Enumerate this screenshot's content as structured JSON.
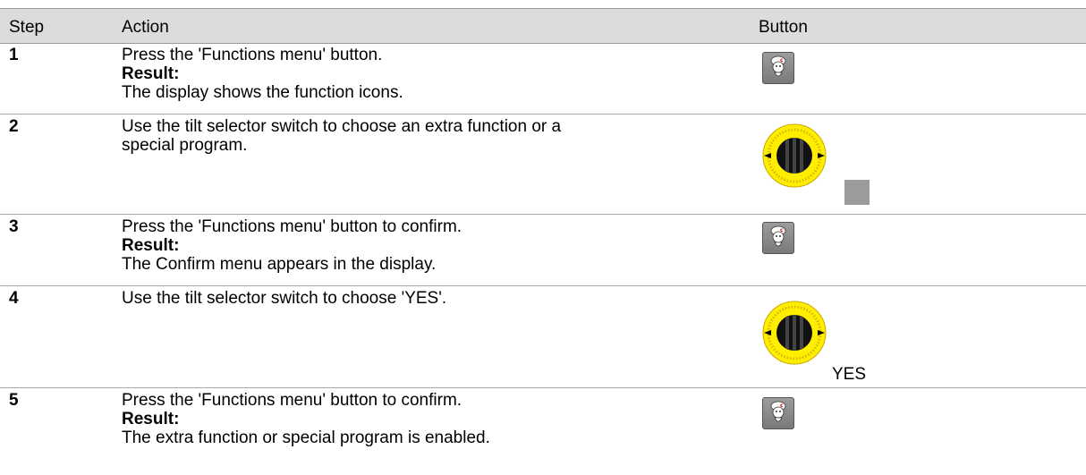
{
  "columns": {
    "step": "Step",
    "action": "Action",
    "button": "Button"
  },
  "rows": [
    {
      "step": "1",
      "action": "Press the 'Functions menu' button.",
      "result_label": "Result:",
      "result": "The display shows the function icons."
    },
    {
      "step": "2",
      "action_line1": "Use the tilt selector switch to choose an extra function or a",
      "action_line2": "special program."
    },
    {
      "step": "3",
      "action": "Press the 'Functions menu' button to confirm.",
      "result_label": "Result:",
      "result": "The Confirm menu appears in the display."
    },
    {
      "step": "4",
      "action": "Use the tilt selector switch to choose 'YES'.",
      "button_text": "YES"
    },
    {
      "step": "5",
      "action": "Press the 'Functions menu' button to confirm.",
      "result_label": "Result:",
      "result": "The extra function or special program is enabled."
    }
  ],
  "icons": {
    "functions_button": "chef-icon",
    "tilt_selector": "tilt-selector-knob-icon"
  },
  "colors": {
    "header_bg": "#dcdcdc",
    "knob_yellow": "#ffee00",
    "button_gray": "#8a8a8a"
  }
}
